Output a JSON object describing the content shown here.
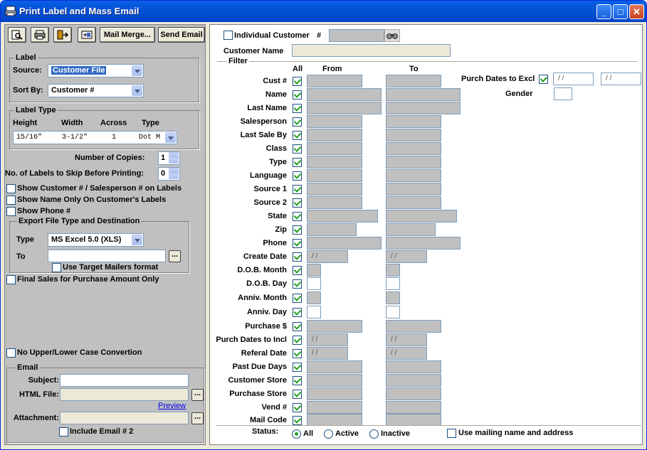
{
  "window": {
    "title": "Print Label and Mass Email",
    "minimize": "_",
    "maximize": "□",
    "close": "✕"
  },
  "toolbar": {
    "mail_merge": "Mail Merge...",
    "send_email": "Send Email"
  },
  "label": {
    "group": "Label",
    "source_label": "Source:",
    "source_value": "Customer File",
    "sortby_label": "Sort By:",
    "sortby_value": "Customer #"
  },
  "label_type": {
    "group": "Label Type",
    "col_height": "Height",
    "col_width": "Width",
    "col_across": "Across",
    "col_type": "Type",
    "height": "15/16\"",
    "width": "3-1/2\"",
    "across": "1",
    "type": "Dot M"
  },
  "copies": {
    "label": "Number of Copies:",
    "value": "1"
  },
  "skip": {
    "label": "No. of Labels to Skip Before Printing:",
    "value": "0"
  },
  "options": {
    "show_cust": "Show Customer # / Salesperson # on Labels",
    "show_name": "Show Name Only On Customer's Labels",
    "show_phone": "Show Phone #"
  },
  "export": {
    "group": "Export File Type and Destination",
    "type_label": "Type",
    "type_value": "MS Excel 5.0 (XLS)",
    "to_label": "To",
    "to_value": "",
    "browse": "...",
    "target": "Use Target Mailers format"
  },
  "final_sales": "Final Sales for Purchase Amount Only",
  "no_case": "No Upper/Lower Case Convertion",
  "email": {
    "group": "Email",
    "subject_label": "Subject:",
    "html_label": "HTML File:",
    "preview": "Preview",
    "attach_label": "Attachment:",
    "browse": "...",
    "include2": "Include Email # 2"
  },
  "top": {
    "individual": "Individual Customer",
    "hash": "#",
    "customer_name": "Customer Name",
    "filter": "Filter"
  },
  "headers": {
    "all": "All",
    "from": "From",
    "to": "To"
  },
  "rows": [
    {
      "label": "Cust #",
      "from": "",
      "to": ""
    },
    {
      "label": "Name",
      "from": "",
      "to": ""
    },
    {
      "label": "Last Name",
      "from": "",
      "to": ""
    },
    {
      "label": "Salesperson",
      "from": "",
      "to": ""
    },
    {
      "label": "Last Sale By",
      "from": "",
      "to": ""
    },
    {
      "label": "Class",
      "from": "",
      "to": ""
    },
    {
      "label": "Type",
      "from": "",
      "to": ""
    },
    {
      "label": "Language",
      "from": "",
      "to": ""
    },
    {
      "label": "Source 1",
      "from": "",
      "to": ""
    },
    {
      "label": "Source 2",
      "from": "",
      "to": ""
    },
    {
      "label": "State",
      "from": "",
      "to": ""
    },
    {
      "label": "Zip",
      "from": "",
      "to": ""
    },
    {
      "label": "Phone",
      "from": "",
      "to": ""
    },
    {
      "label": "Create Date",
      "from": "/ /",
      "to": "/ /"
    },
    {
      "label": "D.O.B. Month",
      "from": "",
      "to": ""
    },
    {
      "label": "D.O.B. Day",
      "from": "",
      "to": ""
    },
    {
      "label": "Anniv. Month",
      "from": "",
      "to": ""
    },
    {
      "label": "Anniv. Day",
      "from": "",
      "to": ""
    },
    {
      "label": "Purchase $",
      "from": "",
      "to": ""
    },
    {
      "label": "Purch Dates to Incl",
      "from": "/ /",
      "to": "/ /"
    },
    {
      "label": "Referal Date",
      "from": "/ /",
      "to": "/ /"
    },
    {
      "label": "Past Due Days",
      "from": "",
      "to": ""
    },
    {
      "label": "Customer Store",
      "from": "",
      "to": ""
    },
    {
      "label": "Purchase Store",
      "from": "",
      "to": ""
    },
    {
      "label": "Vend #",
      "from": "",
      "to": ""
    },
    {
      "label": "Mail Code",
      "from": "",
      "to": ""
    }
  ],
  "excl": {
    "label": "Purch Dates to Excl",
    "from": "/ /",
    "to": "/ /",
    "gender": "Gender"
  },
  "status": {
    "label": "Status:",
    "all": "All",
    "active": "Active",
    "inactive": "Inactive",
    "mailing": "Use mailing name and address"
  }
}
